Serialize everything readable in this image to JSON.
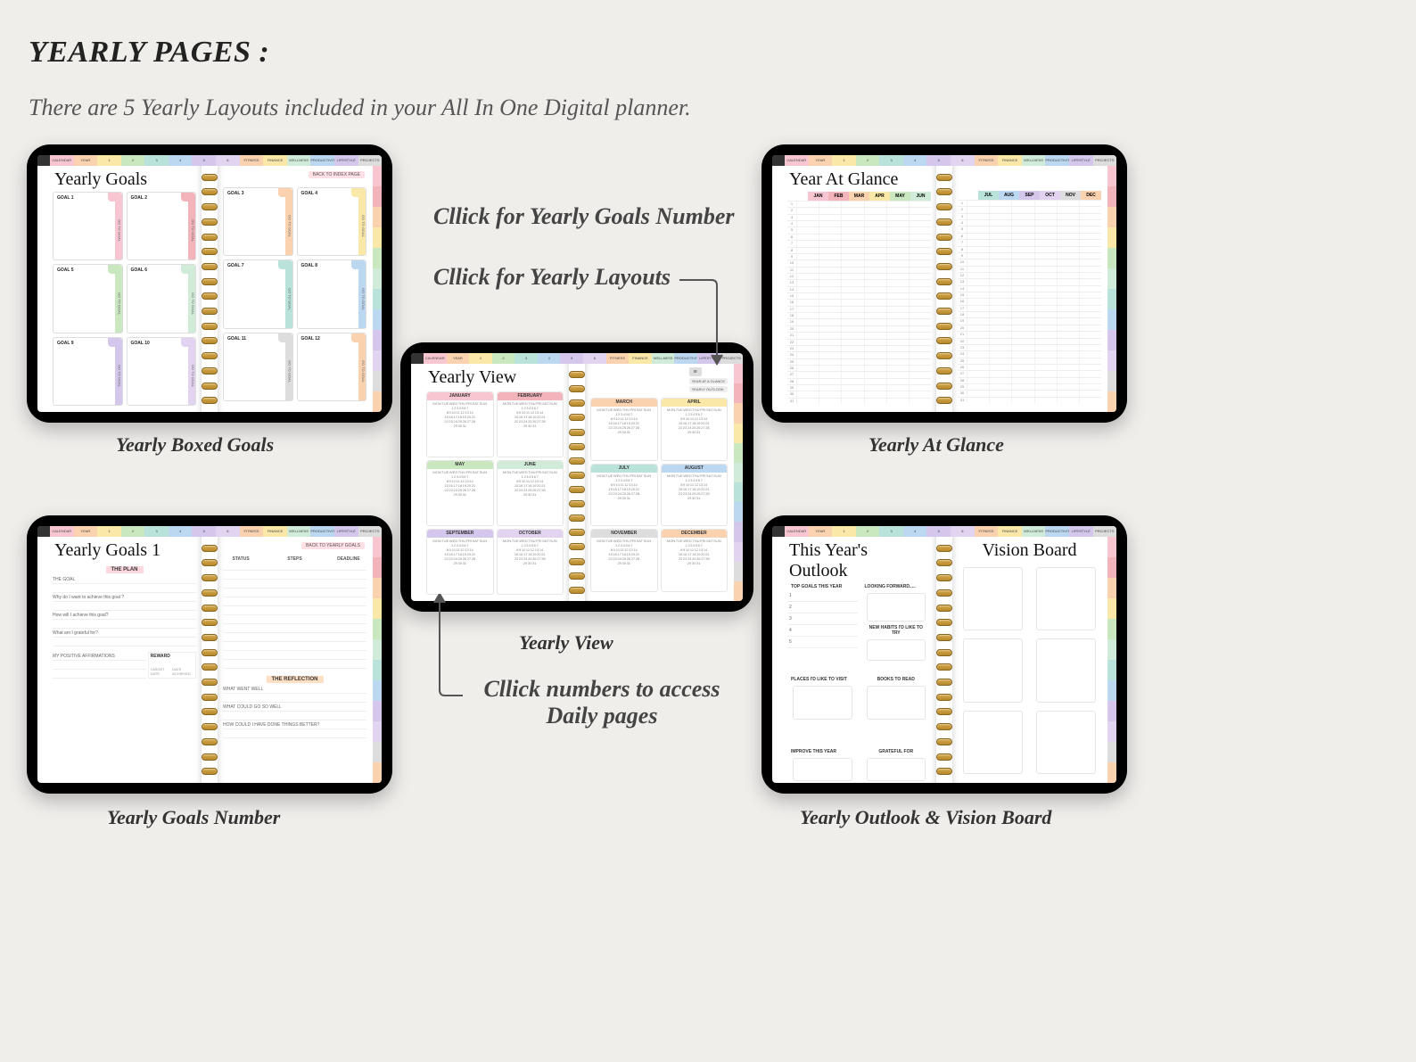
{
  "header": {
    "title": "YEARLY PAGES :",
    "subtitle": "There are 5 Yearly Layouts included in your All In One Digital planner."
  },
  "top_tabs": [
    "CALENDAR",
    "YEAR",
    "1",
    "2",
    "3",
    "4",
    "5",
    "6",
    "FITNESS",
    "FINANCE",
    "WELLNESS",
    "PRODUCTIVITY",
    "LIFESTYLE",
    "PROJECTS"
  ],
  "tab_colors": [
    "c-pink",
    "c-peach",
    "c-yellow",
    "c-green",
    "c-teal",
    "c-blue",
    "c-purple",
    "c-lav",
    "c-peach",
    "c-yellow",
    "c-mint",
    "c-blue",
    "c-purple",
    "c-gray"
  ],
  "side_months": [
    "JAN",
    "FEB",
    "MAR",
    "APR",
    "MAY",
    "JUN",
    "JUL",
    "AUG",
    "SEP",
    "OCT",
    "NOV",
    "DEC"
  ],
  "side_colors": [
    "c-pink",
    "c-red",
    "c-peach",
    "c-yellow",
    "c-green",
    "c-mint",
    "c-teal",
    "c-blue",
    "c-purple",
    "c-lav",
    "c-gray",
    "c-peach"
  ],
  "ipads": {
    "goals": {
      "caption": "Yearly Boxed Goals",
      "title": "Yearly Goals",
      "back": "BACK TO INDEX PAGE",
      "boxes": [
        {
          "n": "GOAL 1",
          "c": "c-pink"
        },
        {
          "n": "GOAL 2",
          "c": "c-red"
        },
        {
          "n": "GOAL 3",
          "c": "c-peach"
        },
        {
          "n": "GOAL 4",
          "c": "c-yellow"
        },
        {
          "n": "GOAL 5",
          "c": "c-green"
        },
        {
          "n": "GOAL 6",
          "c": "c-mint"
        },
        {
          "n": "GOAL 7",
          "c": "c-teal"
        },
        {
          "n": "GOAL 8",
          "c": "c-blue"
        },
        {
          "n": "GOAL 9",
          "c": "c-purple"
        },
        {
          "n": "GOAL 10",
          "c": "c-lav"
        },
        {
          "n": "GOAL 11",
          "c": "c-gray"
        },
        {
          "n": "GOAL 12",
          "c": "c-peach"
        }
      ],
      "go": "GO TO GOAL"
    },
    "glance": {
      "caption": "Yearly At Glance",
      "title": "Year At Glance",
      "months1": [
        "JAN",
        "FEB",
        "MAR",
        "APR",
        "MAY",
        "JUN"
      ],
      "months2": [
        "JUL",
        "AUG",
        "SEP",
        "OCT",
        "NOV",
        "DEC"
      ]
    },
    "view": {
      "caption": "Yearly View",
      "title": "Yearly View",
      "months": [
        "JANUARY",
        "FEBRUARY",
        "MARCH",
        "APRIL",
        "MAY",
        "JUNE",
        "JULY",
        "AUGUST",
        "SEPTEMBER",
        "OCTOBER",
        "NOVEMBER",
        "DECEMBER"
      ],
      "month_colors": [
        "c-pink",
        "c-red",
        "c-peach",
        "c-yellow",
        "c-green",
        "c-mint",
        "c-teal",
        "c-blue",
        "c-purple",
        "c-lav",
        "c-gray",
        "c-peach"
      ],
      "dow": "MON TUE WED THU FRI SAT SUN",
      "menu1": "YEAR AT A GLANCE",
      "menu2": "YEARLY OUTLOOK"
    },
    "goalnum": {
      "caption": "Yearly Goals Number",
      "title": "Yearly Goals 1",
      "back": "BACK TO YEARLY GOALS",
      "plan_h": "THE PLAN",
      "refl_h": "THE REFLECTION",
      "lines": [
        "THE GOAL",
        "Why do I want to achieve this goal ?",
        "How will I achieve this goal?",
        "What am I grateful for?",
        "MY POSITIVE AFFIRMATIONS",
        "REWARD"
      ],
      "cols": [
        "STATUS",
        "STEPS",
        "DEADLINE"
      ],
      "refl": [
        "WHAT WENT WELL",
        "WHAT COULD GO SO WELL",
        "HOW COULD I HAVE DONE THINGS BETTER?"
      ],
      "footer": [
        "TARGET DATE",
        "DATE ACHIEVED"
      ]
    },
    "outlook": {
      "caption": "Yearly Outlook & Vision Board",
      "title_l": "This Year's Outlook",
      "title_r": "Vision Board",
      "sections_l": [
        "TOP GOALS THIS YEAR",
        "PLACES I'D LIKE TO VISIT",
        "IMPROVE THIS YEAR"
      ],
      "sections_r": [
        "LOOKING FORWARD.....",
        "NEW HABITS I'D LIKE TO TRY",
        "BOOKS TO READ",
        "GRATEFUL FOR"
      ],
      "nums": [
        "1",
        "2",
        "3",
        "4",
        "5"
      ]
    }
  },
  "callouts": {
    "goals_num": "Cllick for Yearly Goals Number",
    "layouts": "Cllick for Yearly Layouts",
    "daily1": "Cllick numbers to access",
    "daily2": "Daily pages"
  }
}
